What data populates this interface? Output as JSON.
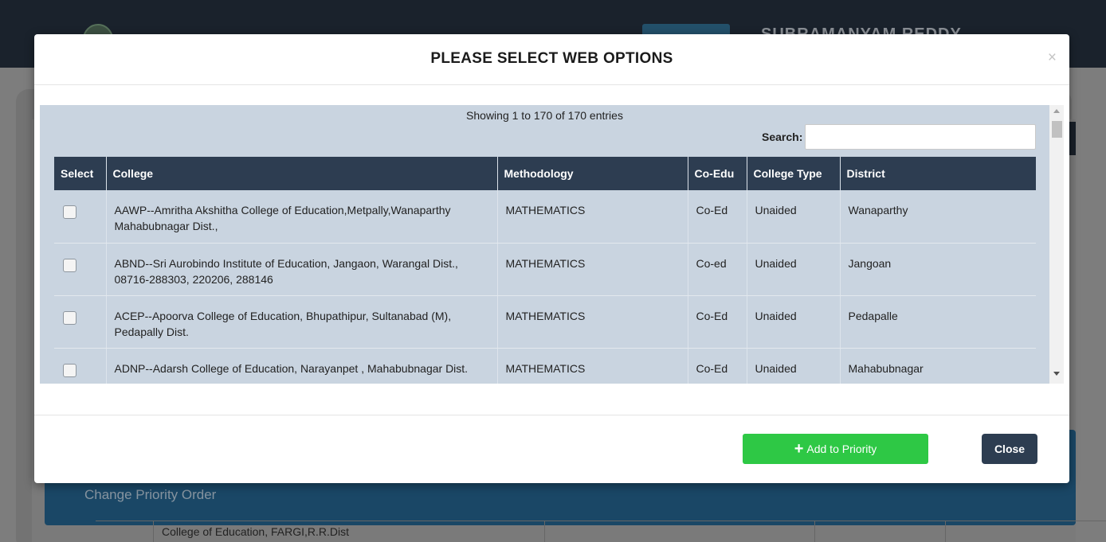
{
  "background": {
    "user_name": "SUBRAMANYAM REDDY",
    "priority_label": "Change Priority Order",
    "partial_row_text": "College of Education, FARGI,R.R.Dist"
  },
  "modal": {
    "title": "PLEASE SELECT WEB OPTIONS",
    "close_symbol": "×",
    "info_text": "Showing 1 to 170 of 170 entries",
    "search_label": "Search:",
    "search_value": "",
    "columns": [
      "Select",
      "College",
      "Methodology",
      "Co-Edu",
      "College Type",
      "District"
    ],
    "rows": [
      {
        "college": "AAWP--Amritha Akshitha College of Education,Metpally,Wanaparthy Mahabubnagar Dist.,",
        "methodology": "MATHEMATICS",
        "co_edu": "Co-Ed",
        "college_type": "Unaided",
        "district": "Wanaparthy",
        "selected": false
      },
      {
        "college": "ABND--Sri Aurobindo Institute of Education, Jangaon, Warangal Dist., 08716-288303, 220206, 288146",
        "methodology": "MATHEMATICS",
        "co_edu": "Co-ed",
        "college_type": "Unaided",
        "district": "Jangoan",
        "selected": false
      },
      {
        "college": "ACEP--Apoorva College of Education, Bhupathipur, Sultanabad (M), Pedapally Dist.",
        "methodology": "MATHEMATICS",
        "co_edu": "Co-Ed",
        "college_type": "Unaided",
        "district": "Pedapalle",
        "selected": false
      },
      {
        "college": "ADNP--Adarsh College of Education, Narayanpet , Mahabubnagar Dist.",
        "methodology": "MATHEMATICS",
        "co_edu": "Co-Ed",
        "college_type": "Unaided",
        "district": "Mahabubnagar",
        "selected": false
      }
    ],
    "add_button_label": "Add to Priority",
    "add_button_icon": "plus-icon",
    "close_button_label": "Close"
  },
  "colors": {
    "header_dark": "#2d3d51",
    "table_bg": "#c9d4e0",
    "add_green": "#2ec845",
    "overlay_bg": "#7d7d7d"
  }
}
